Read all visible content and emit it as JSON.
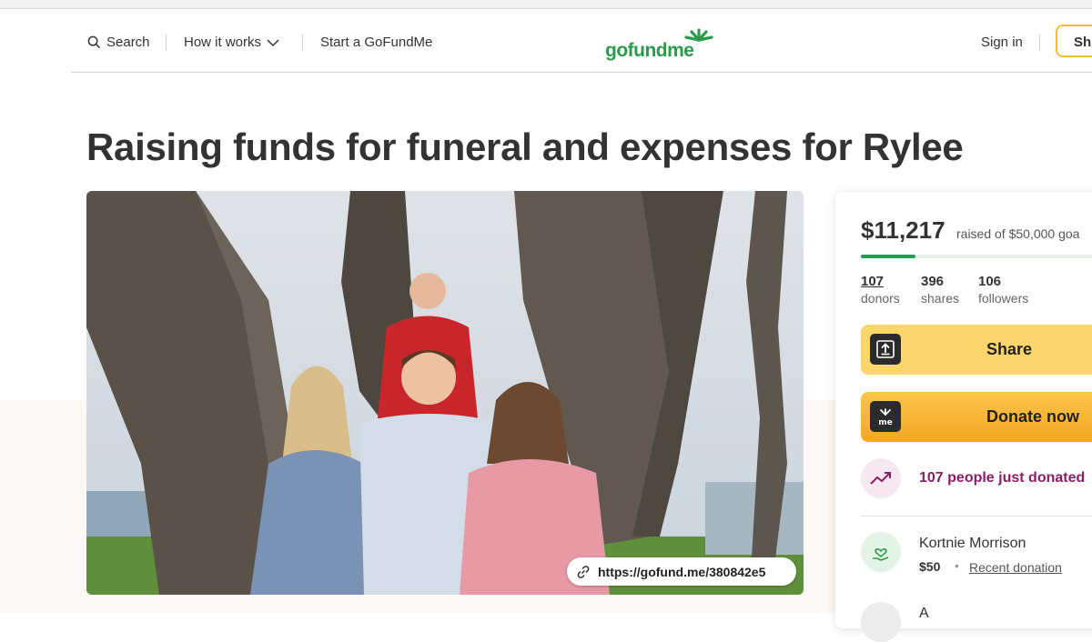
{
  "header": {
    "search_label": "Search",
    "how_label": "How it works",
    "start_label": "Start a GoFundMe",
    "logo_text": "gofundme",
    "signin_label": "Sign in",
    "share_label": "Sh"
  },
  "campaign": {
    "title": "Raising funds for funeral and expenses for Rylee",
    "photo_url": "https://gofund.me/380842e5"
  },
  "donation_card": {
    "amount": "$11,217",
    "raised_text": "raised of $50,000 goa",
    "progress": 0.224,
    "stats": [
      {
        "num": "107",
        "label": "donors"
      },
      {
        "num": "396",
        "label": "shares"
      },
      {
        "num": "106",
        "label": "followers"
      }
    ],
    "share_button": "Share",
    "donate_button": "Donate now",
    "trending_text": "107 people just donated",
    "recent_donor": {
      "name": "Kortnie Morrison",
      "amount": "$50",
      "separator": "•",
      "tag": "Recent donation"
    },
    "next_donor_initial": "A"
  },
  "colors": {
    "brand_green": "#2b9a4b",
    "progress_green": "#1c9f4e",
    "share_yellow": "#fbd66a",
    "donate_orange": "#f5a623",
    "trending_purple": "#8a1e66"
  }
}
